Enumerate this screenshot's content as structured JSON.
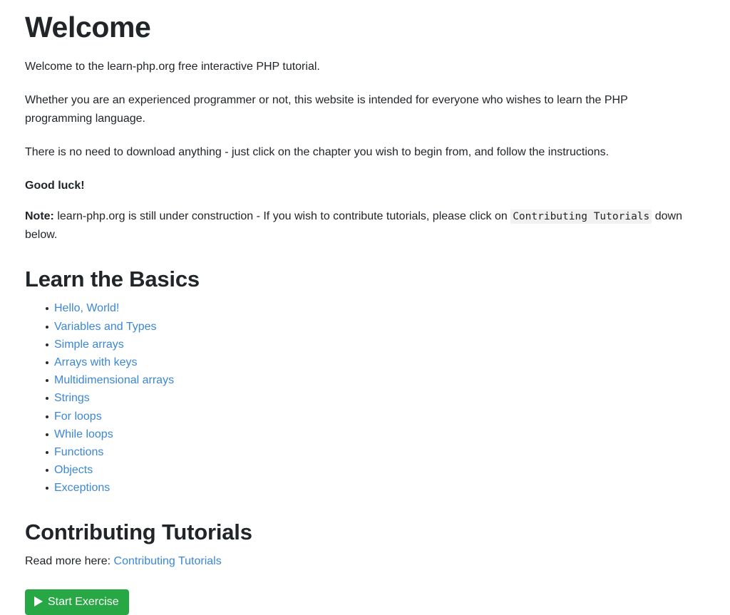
{
  "page": {
    "title": "Welcome",
    "intro_paragraph": "Welcome to the learn-php.org free interactive PHP tutorial.",
    "audience_paragraph": "Whether you are an experienced programmer or not, this website is intended for everyone who wishes to learn the PHP programming language.",
    "instructions_paragraph": "There is no need to download anything - just click on the chapter you wish to begin from, and follow the instructions.",
    "good_luck": "Good luck!",
    "note": {
      "label": "Note:",
      "text_before_code": " learn-php.org is still under construction - If you wish to contribute tutorials, please click on ",
      "code": "Contributing Tutorials",
      "text_after_code": " down below."
    }
  },
  "basics": {
    "heading": "Learn the Basics",
    "items": [
      {
        "label": "Hello, World!"
      },
      {
        "label": "Variables and Types"
      },
      {
        "label": "Simple arrays"
      },
      {
        "label": "Arrays with keys"
      },
      {
        "label": "Multidimensional arrays"
      },
      {
        "label": "Strings"
      },
      {
        "label": "For loops"
      },
      {
        "label": "While loops"
      },
      {
        "label": "Functions"
      },
      {
        "label": "Objects"
      },
      {
        "label": "Exceptions"
      }
    ]
  },
  "contributing": {
    "heading": "Contributing Tutorials",
    "read_more_label": "Read more here: ",
    "link_label": "Contributing Tutorials"
  },
  "actions": {
    "start_exercise_label": "Start Exercise",
    "play_icon": "play-icon"
  },
  "colors": {
    "link": "#3b87d6",
    "button_green": "#28a745",
    "text": "#212529",
    "code_background": "#f1f1f1"
  }
}
